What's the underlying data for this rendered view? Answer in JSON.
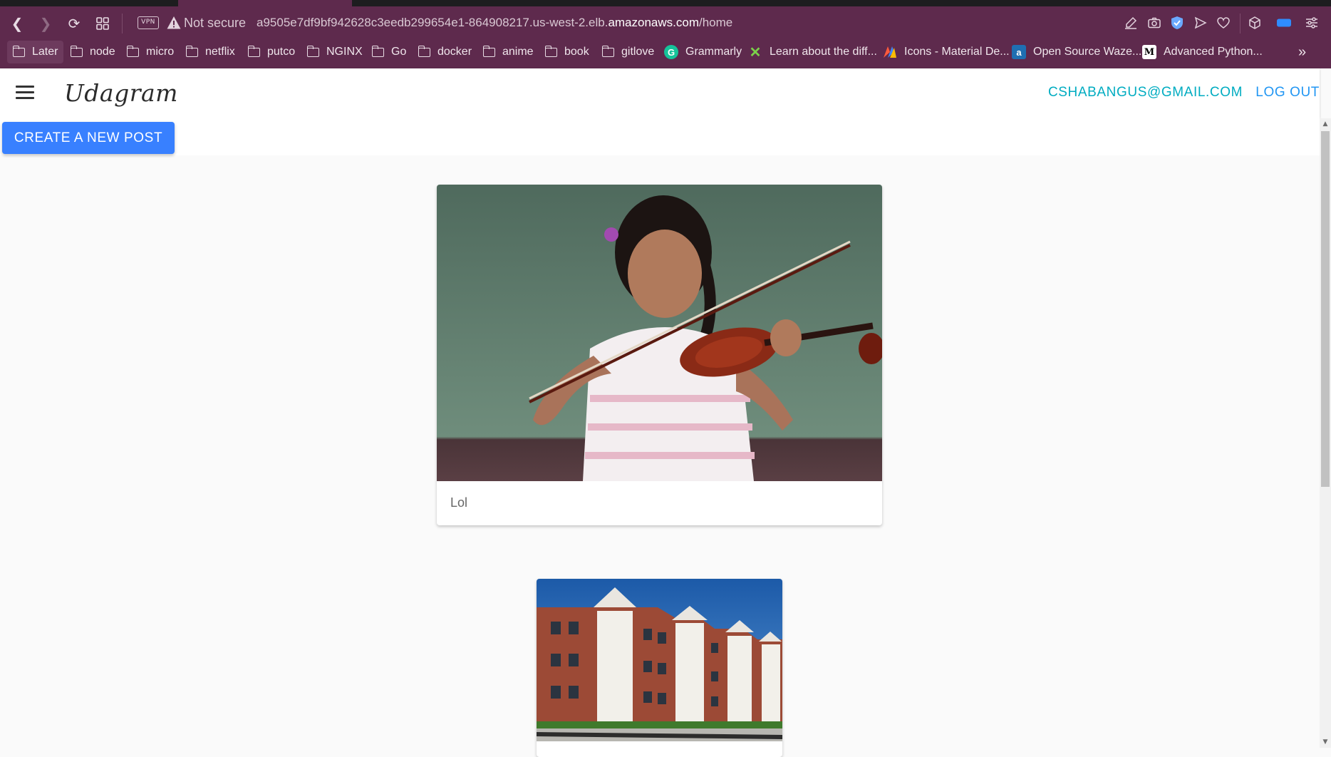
{
  "browser": {
    "vpn_label": "VPN",
    "security_label": "Not secure",
    "url_prefix": "a9505e7df9bf942628c3eedb299654e1-864908217.us-west-2.elb.",
    "url_domain": "amazonaws.com",
    "url_path": "/home",
    "bookmarks": [
      {
        "label": "Later",
        "icon": "folder-icon"
      },
      {
        "label": "node",
        "icon": "folder-icon"
      },
      {
        "label": "micro",
        "icon": "folder-icon"
      },
      {
        "label": "netflix",
        "icon": "folder-icon"
      },
      {
        "label": "putco",
        "icon": "folder-icon"
      },
      {
        "label": "NGINX",
        "icon": "folder-icon"
      },
      {
        "label": "Go",
        "icon": "folder-icon"
      },
      {
        "label": "docker",
        "icon": "folder-icon"
      },
      {
        "label": "anime",
        "icon": "folder-icon"
      },
      {
        "label": "book",
        "icon": "folder-icon"
      },
      {
        "label": "gitlove",
        "icon": "folder-icon"
      },
      {
        "label": "Grammarly",
        "icon": "grammarly-icon"
      },
      {
        "label": "Learn about the diff...",
        "icon": "x-icon"
      },
      {
        "label": "Icons - Material De...",
        "icon": "material-icon"
      },
      {
        "label": "Open Source Waze...",
        "icon": "a-icon"
      },
      {
        "label": "Advanced Python...",
        "icon": "medium-icon"
      }
    ],
    "more_bookmarks": "»"
  },
  "app": {
    "brand": "Udagram",
    "user_email": "CSHABANGUS@GMAIL.COM",
    "logout_label": "LOG OUT",
    "create_post_label": "CREATE A NEW POST",
    "accent_color": "#3880ff"
  },
  "feed": {
    "posts": [
      {
        "caption": "Lol",
        "image": "girl-playing-violin"
      },
      {
        "caption": "",
        "image": "apartment-building"
      }
    ]
  }
}
